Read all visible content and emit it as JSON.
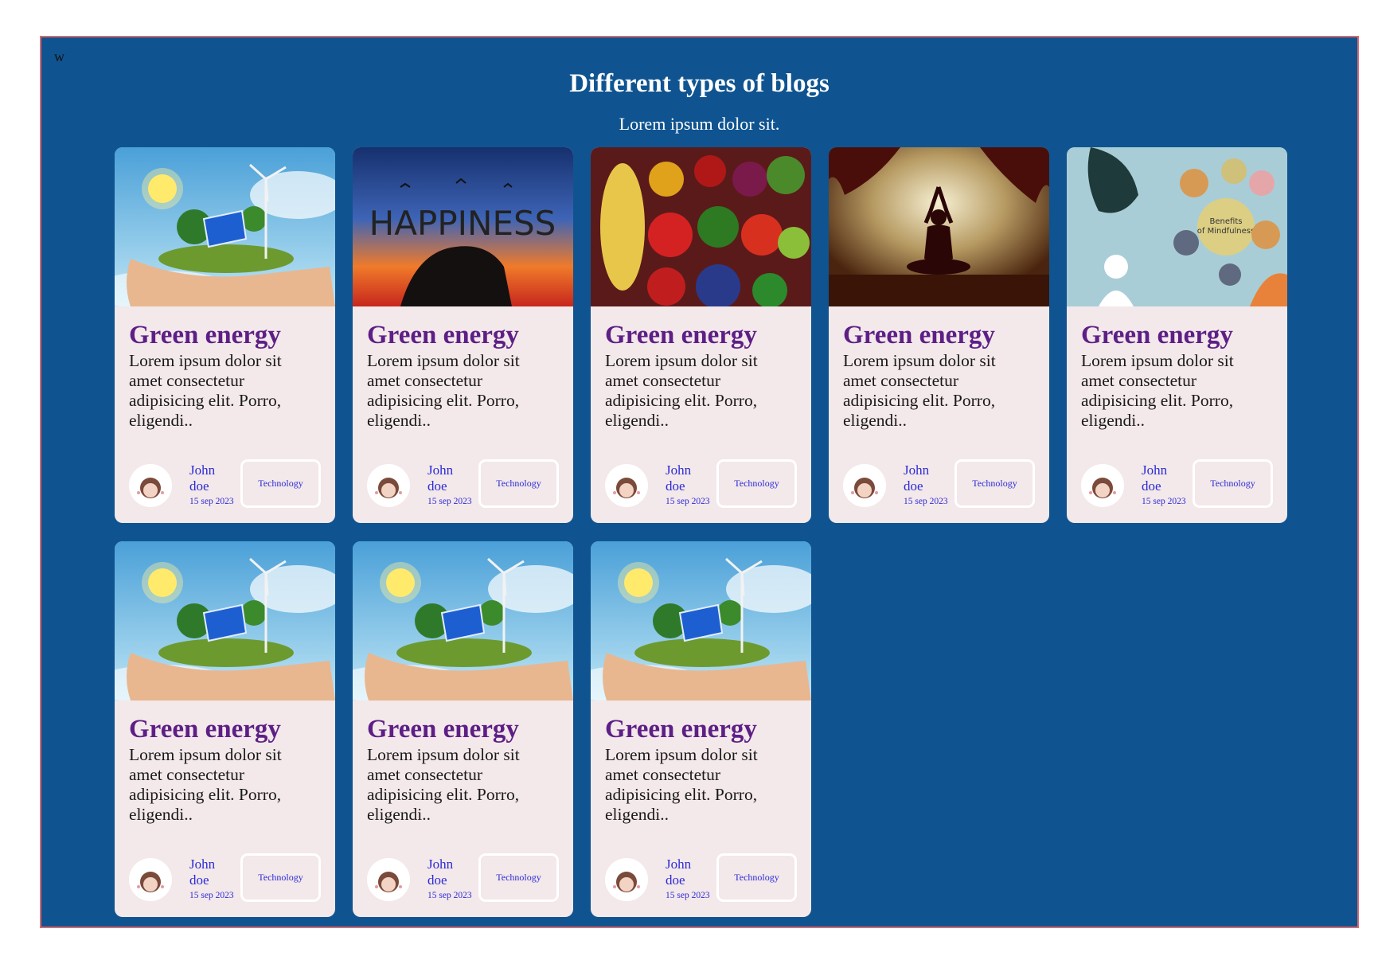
{
  "corner_label": "w",
  "heading": "Different types of blogs",
  "subheading": "Lorem ipsum dolor sit.",
  "colors": {
    "page_bg": "#0f5490",
    "frame_border": "#d56a72",
    "card_bg": "#f3e8ea",
    "title": "#5d1f86",
    "link": "#2b2bd6"
  },
  "cards": [
    {
      "image": "green-energy-hand-image",
      "title": "Green energy",
      "text": "Lorem ipsum dolor sit amet consectetur adipisicing elit. Porro, eligendi..",
      "author_first": "John",
      "author_last": "doe",
      "date": "15 sep 2023",
      "tag": "Technology"
    },
    {
      "image": "happiness-sunset-image",
      "title": "Green energy",
      "text": "Lorem ipsum dolor sit amet consectetur adipisicing elit. Porro, eligendi..",
      "author_first": "John",
      "author_last": "doe",
      "date": "15 sep 2023",
      "tag": "Technology",
      "image_text": "HAPPINESS"
    },
    {
      "image": "vegetables-image",
      "title": "Green energy",
      "text": "Lorem ipsum dolor sit amet consectetur adipisicing elit. Porro, eligendi..",
      "author_first": "John",
      "author_last": "doe",
      "date": "15 sep 2023",
      "tag": "Technology"
    },
    {
      "image": "meditation-silhouette-image",
      "title": "Green energy",
      "text": "Lorem ipsum dolor sit amet consectetur adipisicing elit. Porro, eligendi..",
      "author_first": "John",
      "author_last": "doe",
      "date": "15 sep 2023",
      "tag": "Technology"
    },
    {
      "image": "mindfulness-benefits-image",
      "title": "Green energy",
      "text": "Lorem ipsum dolor sit amet consectetur adipisicing elit. Porro, eligendi..",
      "author_first": "John",
      "author_last": "doe",
      "date": "15 sep 2023",
      "tag": "Technology",
      "image_text": "Benefits of Mindfulness"
    },
    {
      "image": "green-energy-hand-image",
      "title": "Green energy",
      "text": "Lorem ipsum dolor sit amet consectetur adipisicing elit. Porro, eligendi..",
      "author_first": "John",
      "author_last": "doe",
      "date": "15 sep 2023",
      "tag": "Technology"
    },
    {
      "image": "green-energy-hand-image",
      "title": "Green energy",
      "text": "Lorem ipsum dolor sit amet consectetur adipisicing elit. Porro, eligendi..",
      "author_first": "John",
      "author_last": "doe",
      "date": "15 sep 2023",
      "tag": "Technology"
    },
    {
      "image": "green-energy-hand-image",
      "title": "Green energy",
      "text": "Lorem ipsum dolor sit amet consectetur adipisicing elit. Porro, eligendi..",
      "author_first": "John",
      "author_last": "doe",
      "date": "15 sep 2023",
      "tag": "Technology"
    }
  ]
}
